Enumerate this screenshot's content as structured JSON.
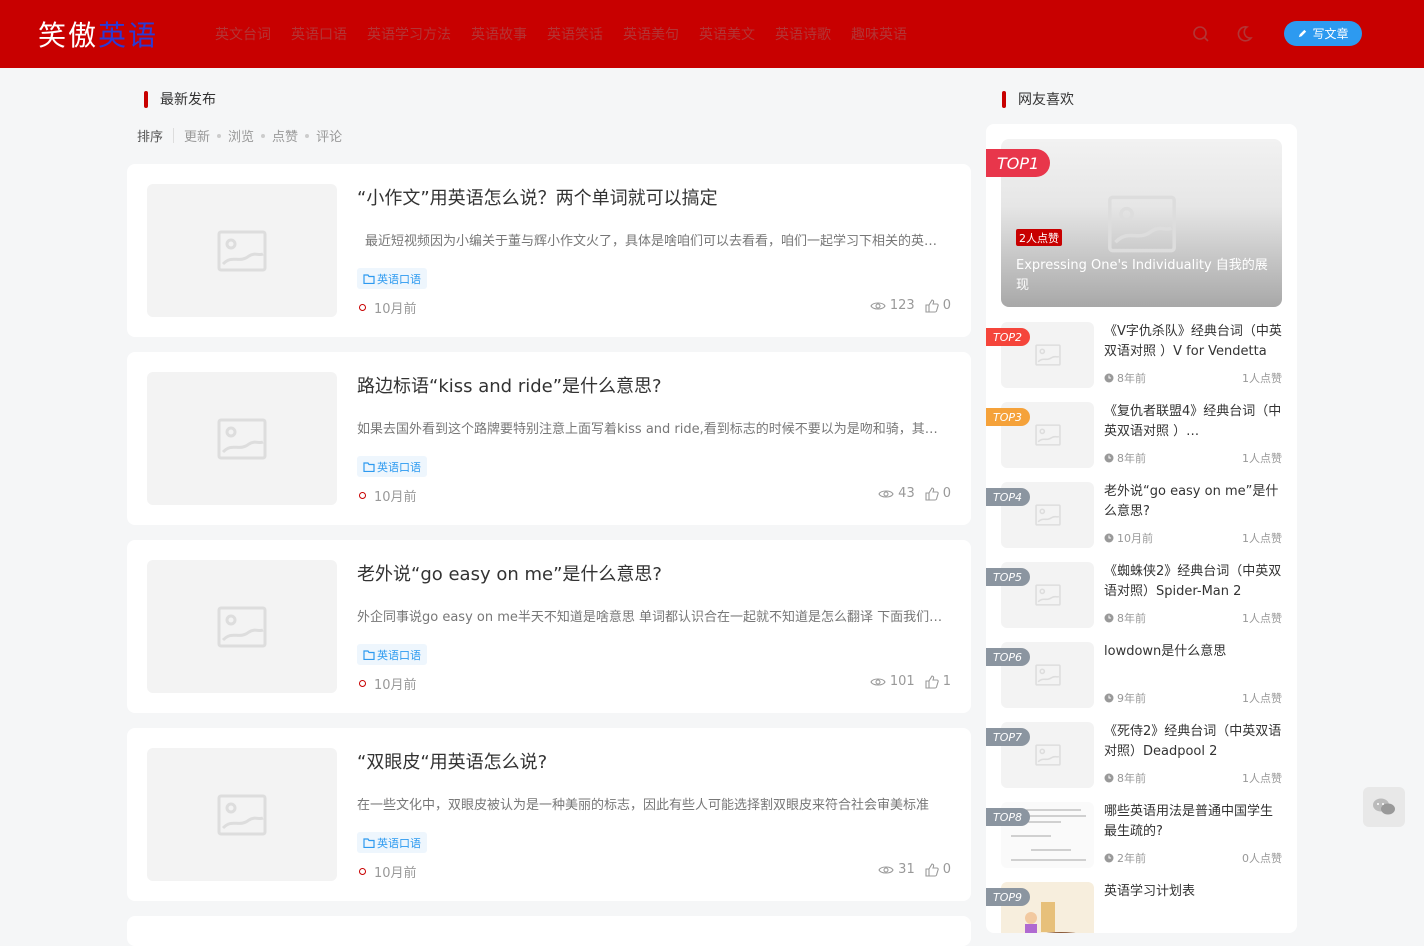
{
  "site": {
    "logo_part1": "笑傲",
    "logo_part2": "英语",
    "nav": [
      "英文台词",
      "英语口语",
      "英语学习方法",
      "英语故事",
      "英语笑话",
      "英语美句",
      "英语美文",
      "英语诗歌",
      "趣味英语"
    ],
    "write_label": "写文章"
  },
  "latest": {
    "title": "最新发布",
    "sort_label": "排序",
    "sort_options": [
      "更新",
      "浏览",
      "点赞",
      "评论"
    ],
    "posts": [
      {
        "title": "“小作文”用英语怎么说？两个单词就可以搞定",
        "desc": "最近短视频因为小编关于董与辉小作文火了，具体是啥咱们可以去看看，咱们一起学习下相关的英语表达吧",
        "tag": "英语口语",
        "time": "10月前",
        "views": "123",
        "likes": "0"
      },
      {
        "title": "路边标语“kiss and ride”是什么意思?",
        "desc": "如果去国外看到这个路牌要特别注意上面写着kiss and ride,看到标志的时候不要以为是吻和骑，其实是送人下车的意思",
        "tag": "英语口语",
        "time": "10月前",
        "views": "43",
        "likes": "0"
      },
      {
        "title": "老外说“go easy on me”是什么意思?",
        "desc": "外企同事说go easy on me半天不知道是啥意思 单词都认识合在一起就不知道是怎么翻译 下面我们一起来看看",
        "tag": "英语口语",
        "time": "10月前",
        "views": "101",
        "likes": "1"
      },
      {
        "title": "“双眼皮“用英语怎么说?",
        "desc": "在一些文化中，双眼皮被认为是一种美丽的标志，因此有些人可能选择割双眼皮来符合社会审美标准",
        "tag": "英语口语",
        "time": "10月前",
        "views": "31",
        "likes": "0"
      }
    ]
  },
  "popular": {
    "title": "网友喜欢",
    "top1": {
      "badge": "TOP1",
      "likes": "2人点赞",
      "title": "Expressing One's Individuality 自我的展现"
    },
    "items": [
      {
        "badge": "TOP2",
        "title": "《V字仇杀队》经典台词（中英双语对照 ）V for Vendetta",
        "time": "8年前",
        "likes": "1人点赞"
      },
      {
        "badge": "TOP3",
        "title": "《复仇者联盟4》经典台词（中英双语对照 ）…",
        "time": "8年前",
        "likes": "1人点赞"
      },
      {
        "badge": "TOP4",
        "title": "老外说“go easy on me”是什么意思?",
        "time": "10月前",
        "likes": "1人点赞"
      },
      {
        "badge": "TOP5",
        "title": "《蜘蛛侠2》经典台词（中英双语对照）Spider-Man 2",
        "time": "8年前",
        "likes": "1人点赞"
      },
      {
        "badge": "TOP6",
        "title": "lowdown是什么意思",
        "time": "9年前",
        "likes": "1人点赞"
      },
      {
        "badge": "TOP7",
        "title": "《死侍2》经典台词（中英双语对照）Deadpool 2",
        "time": "8年前",
        "likes": "1人点赞"
      },
      {
        "badge": "TOP8",
        "title": "哪些英语用法是普通中国学生最生疏的?",
        "time": "2年前",
        "likes": "0人点赞"
      },
      {
        "badge": "TOP9",
        "title": "英语学习计划表",
        "time": "",
        "likes": ""
      }
    ]
  },
  "colors": {
    "brand": "#c80000",
    "accent": "#2d9af0",
    "top1": "#e8364b",
    "top2": "#f5453b",
    "top3": "#f5a23a",
    "top_other": "#8b95a0"
  }
}
